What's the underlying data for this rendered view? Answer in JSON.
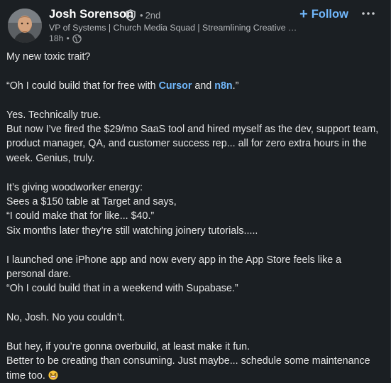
{
  "post": {
    "author": {
      "name": "Josh Sorenson",
      "degree": "2nd",
      "degree_dot": "•",
      "headline": "VP of Systems | Church Media Squad | Streamlining Creative Op...",
      "time": "18h",
      "time_sep": "•",
      "visibility_icon": "globe-icon",
      "verified_icon": "verified-shield-icon"
    },
    "follow": {
      "label": "Follow",
      "icon": "+"
    },
    "more_icon": "ellipsis-icon",
    "body": {
      "p1": "My new toxic trait?",
      "p2_before": "“Oh I could build that for free with ",
      "p2_link1": "Cursor",
      "p2_mid": " and ",
      "p2_link2": "n8n",
      "p2_after": ".”",
      "p3_line1": "Yes. Technically true.",
      "p3_line2": "But now I’ve fired the $29/mo SaaS tool and hired myself as the dev, support team, product manager, QA, and customer success rep... all for zero extra hours in the week. Genius, truly.",
      "p4_line1": "It’s giving woodworker energy:",
      "p4_line2": "Sees a $150 table at Target and says,",
      "p4_line3": "“I could make that for like... $40.”",
      "p4_line4": "Six months later they’re still watching joinery tutorials.....",
      "p5_line1": "I launched one iPhone app and now every app in the App Store feels like a personal dare.",
      "p5_line2": "“Oh I could build that in a weekend with Supabase.”",
      "p6": "No, Josh. No you couldn’t.",
      "p7_line1": "But hey, if you’re gonna overbuild, at least make it fun.",
      "p7_line2": "Better to be creating than consuming. Just maybe... schedule some maintenance time too.",
      "emoji": "grinning-squinting-face-icon"
    },
    "colors": {
      "background": "#1b1f23",
      "link": "#71b7fb",
      "text": "#e6e6e6",
      "muted": "#a5a8ab"
    }
  }
}
